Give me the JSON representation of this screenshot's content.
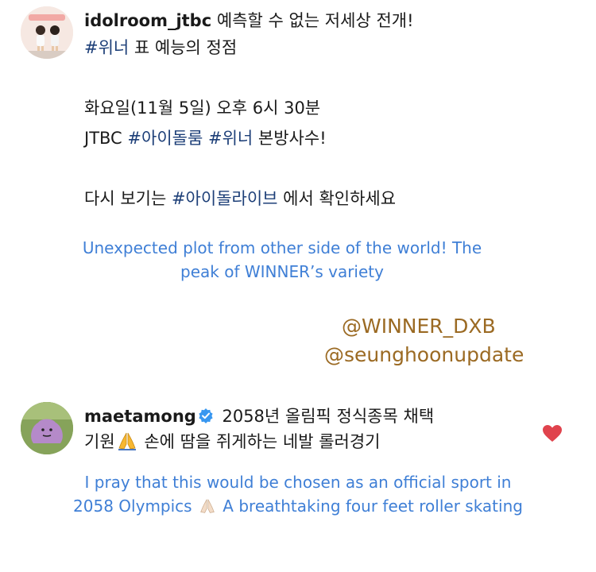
{
  "post": {
    "username": "idolroom_jtbc",
    "caption_line1": "예측할 수 없는 저세상 전개!",
    "caption_line2_tag": "#위너",
    "caption_line2_rest": " 표 예능의 정점",
    "schedule": "화요일(11월 5일) 오후 6시 30분",
    "broadcast_prefix": "JTBC ",
    "broadcast_tag1": "#아이돌룸",
    "broadcast_tag2": "#위너",
    "broadcast_suffix": " 본방사수!",
    "replay_prefix": "다시 보기는 ",
    "replay_tag": "#아이돌라이브",
    "replay_suffix": " 에서 확인하세요"
  },
  "translation1": {
    "line1": "Unexpected plot from other side of the world! The",
    "line2": "peak of WINNER’s variety"
  },
  "credits": {
    "handle1": "@WINNER_DXB",
    "handle2": "@seunghoonupdate"
  },
  "comment": {
    "username": "maetamong",
    "verified_icon": "verified-badge-icon",
    "text_line1": " 2058년 올림픽 정식종목 채택",
    "text_line2_a": "기원",
    "pray_icon": "praying-hands-emoji",
    "text_line2_b": " 손에 땀을 쥐게하는 네발 롤러경기",
    "like_icon": "heart-icon",
    "like_color": "#e0434d"
  },
  "translation2": {
    "line1": "I pray that this would be chosen as an official sport in",
    "line2a": "2058 Olympics ",
    "line2b": " A breathtaking four feet roller skating"
  },
  "colors": {
    "hashtag": "#1d3f78",
    "translation": "#3f7fd6",
    "handles": "#9b6a23"
  }
}
